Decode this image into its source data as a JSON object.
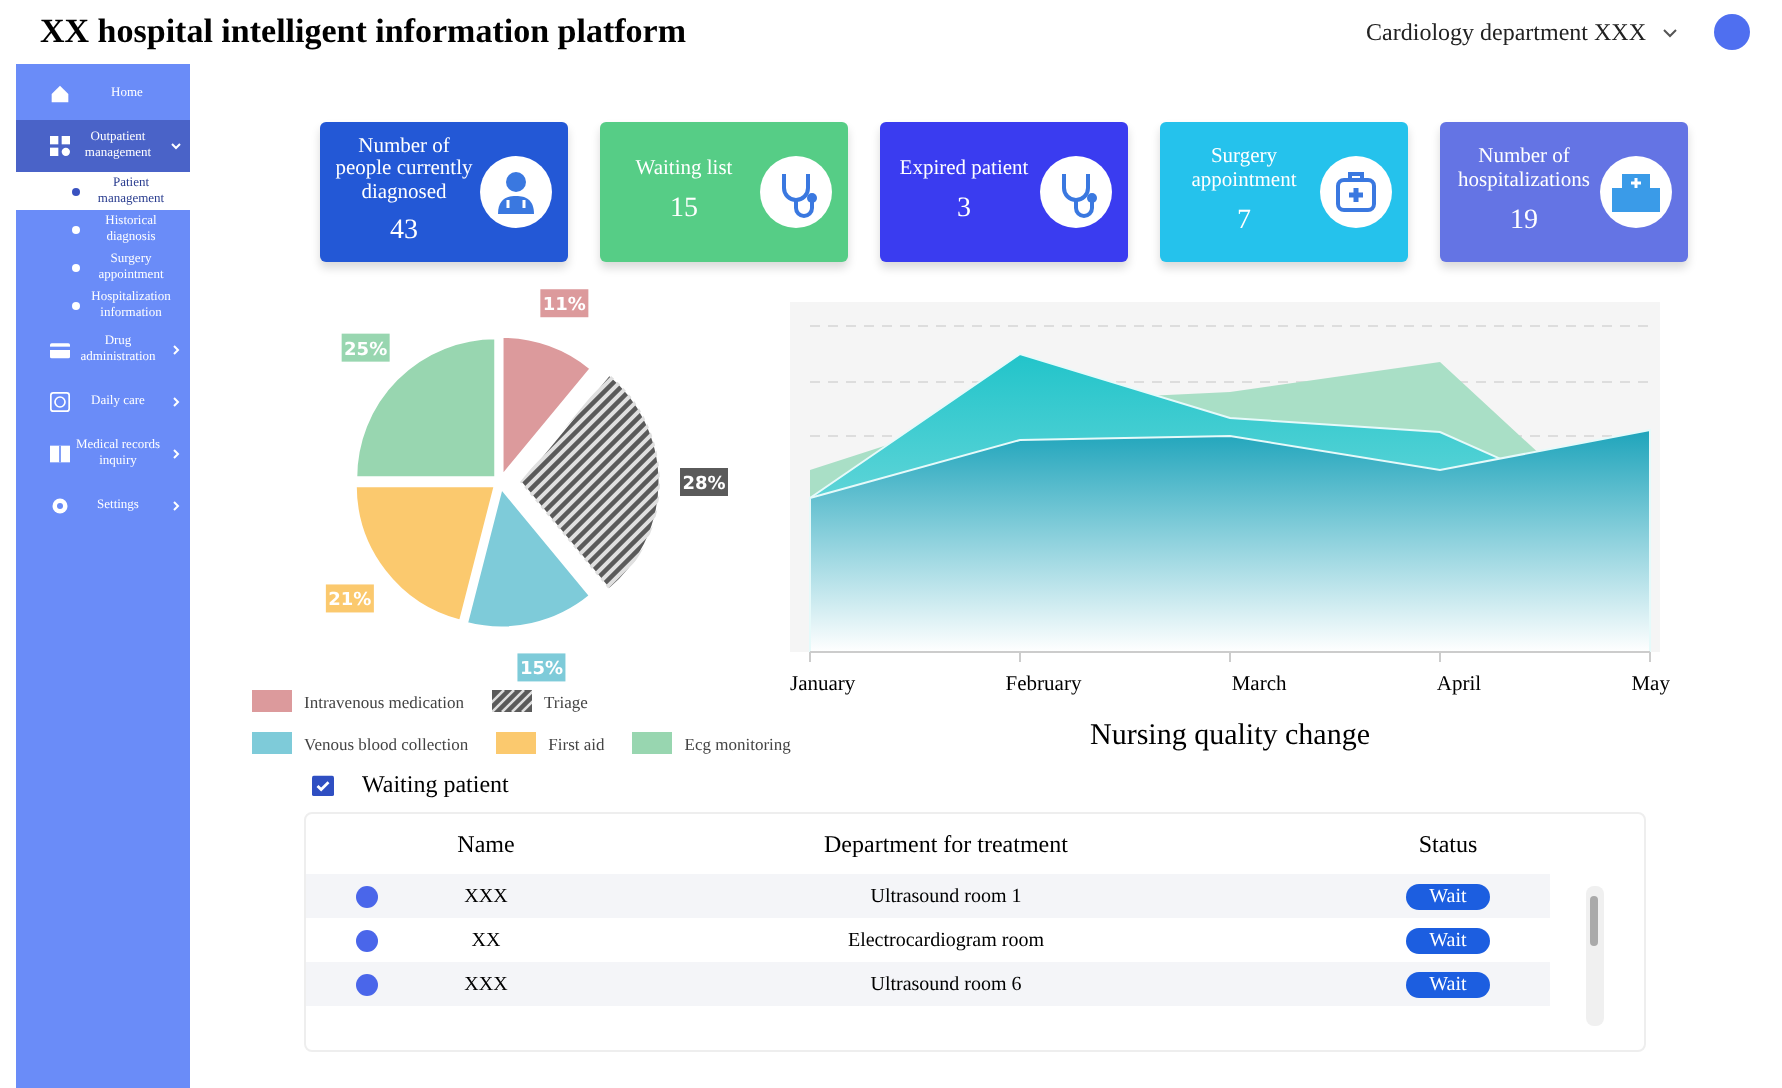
{
  "header": {
    "title": "XX hospital intelligent information platform",
    "department": "Cardiology department XXX"
  },
  "sidebar": {
    "items": [
      {
        "label": "Home",
        "kind": "link",
        "selected": false,
        "expanded": false
      },
      {
        "label": "Outpatient management",
        "kind": "menu",
        "selected": true,
        "expanded": true,
        "children": [
          {
            "label": "Patient management",
            "selected": true
          },
          {
            "label": "Historical diagnosis",
            "selected": false
          },
          {
            "label": "Surgery appointment",
            "selected": false
          },
          {
            "label": "Hospitalization information",
            "selected": false
          }
        ]
      },
      {
        "label": "Drug administration",
        "kind": "menu",
        "selected": false,
        "expanded": false
      },
      {
        "label": "Daily care",
        "kind": "menu",
        "selected": false,
        "expanded": false
      },
      {
        "label": "Medical records inquiry",
        "kind": "menu",
        "selected": false,
        "expanded": false
      },
      {
        "label": "Settings",
        "kind": "menu",
        "selected": false,
        "expanded": false
      }
    ]
  },
  "stats": [
    {
      "label": "Number of people currently diagnosed",
      "value": "43",
      "color": "#2358d6"
    },
    {
      "label": "Waiting list",
      "value": "15",
      "color": "#56cd86"
    },
    {
      "label": "Expired patient",
      "value": "3",
      "color": "#3a3cf0"
    },
    {
      "label": "Surgery appointment",
      "value": "7",
      "color": "#25c2ec"
    },
    {
      "label": "Number of hospitalizations",
      "value": "19",
      "color": "#6474e4"
    }
  ],
  "pie": {
    "chart_data": {
      "type": "pie",
      "categories": [
        "Intravenous medication",
        "Triage",
        "Venous blood collection",
        "First aid",
        "Ecg monitoring"
      ],
      "values": [
        11,
        28,
        15,
        21,
        25
      ],
      "colors": [
        "#dc9a9c",
        "#5a5a5a",
        "#7ecbd9",
        "#fbc96e",
        "#98d6b0"
      ],
      "value_labels": [
        "11%",
        "28%",
        "15%",
        "21%",
        "25%"
      ],
      "legend": "bottom"
    }
  },
  "area_chart": {
    "x_labels": [
      "January",
      "February",
      "March",
      "April",
      "May"
    ],
    "title": "Nursing quality change"
  },
  "waiting": {
    "title": "Waiting patient",
    "columns": [
      "Name",
      "Department for treatment",
      "Status"
    ],
    "rows": [
      {
        "name": "XXX",
        "department": "Ultrasound room 1",
        "status": "Wait"
      },
      {
        "name": "XX",
        "department": "Electrocardiogram room",
        "status": "Wait"
      },
      {
        "name": "XXX",
        "department": "Ultrasound room 6",
        "status": "Wait"
      }
    ]
  }
}
